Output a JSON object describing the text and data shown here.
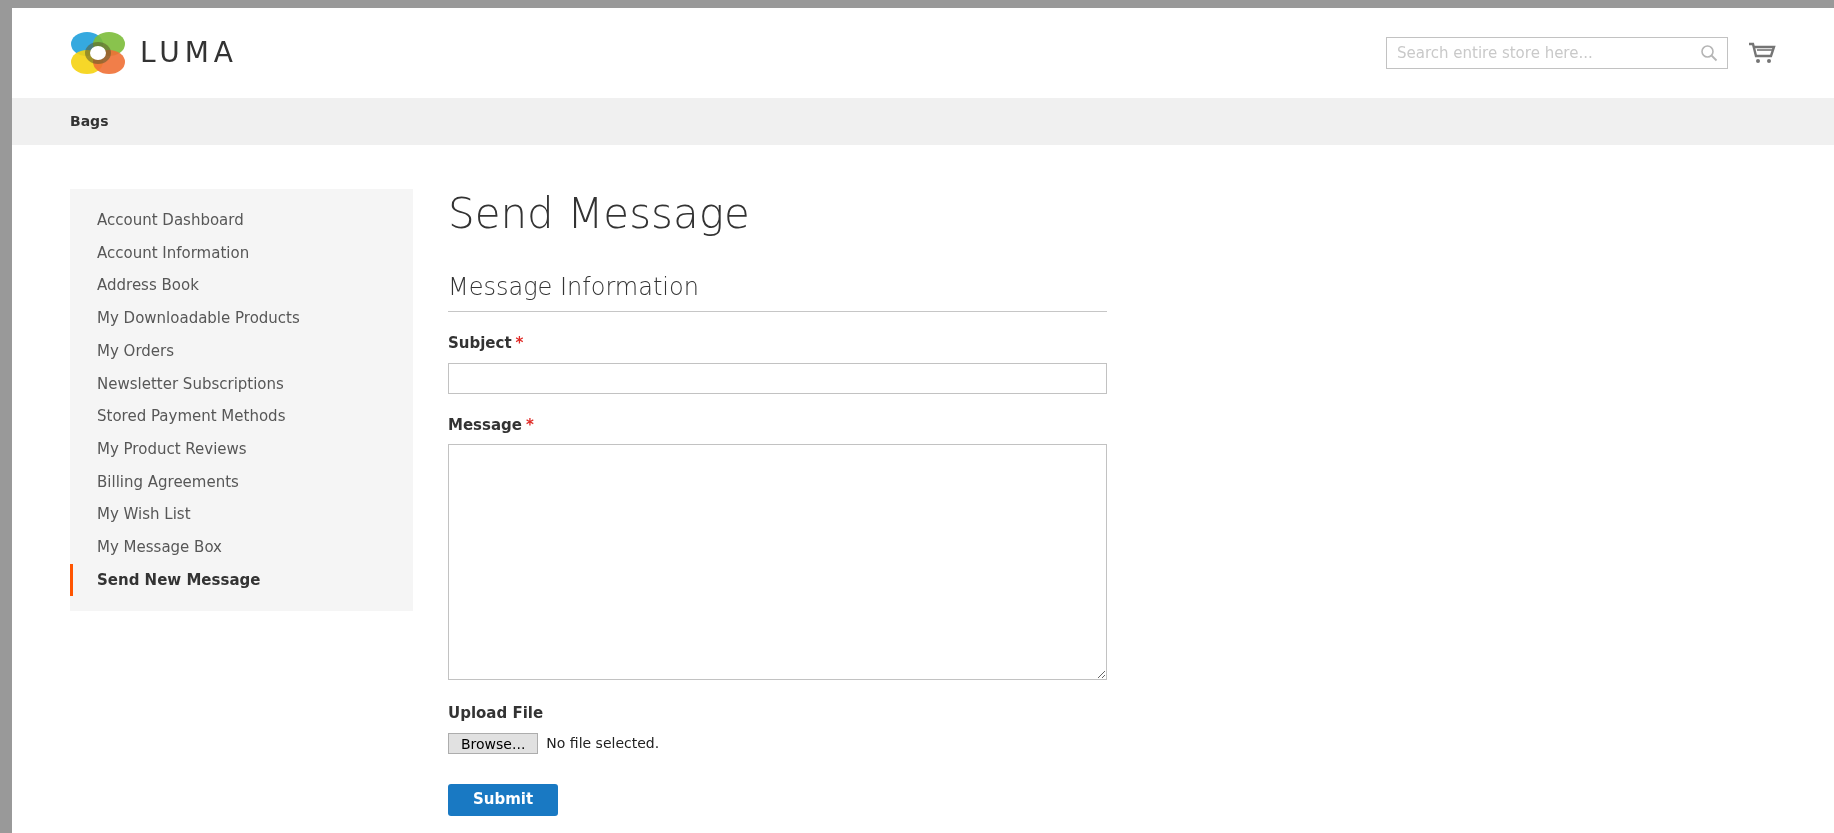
{
  "header": {
    "logo_text": "LUMA",
    "search": {
      "placeholder": "Search entire store here..."
    }
  },
  "nav": {
    "items": [
      {
        "label": "Bags",
        "selected": false
      }
    ]
  },
  "sidebar": {
    "items": [
      {
        "label": "Account Dashboard",
        "selected": false
      },
      {
        "label": "Account Information",
        "selected": false
      },
      {
        "label": "Address Book",
        "selected": false
      },
      {
        "label": "My Downloadable Products",
        "selected": false
      },
      {
        "label": "My Orders",
        "selected": false
      },
      {
        "label": "Newsletter Subscriptions",
        "selected": false
      },
      {
        "label": "Stored Payment Methods",
        "selected": false
      },
      {
        "label": "My Product Reviews",
        "selected": false
      },
      {
        "label": "Billing Agreements",
        "selected": false
      },
      {
        "label": "My Wish List",
        "selected": false
      },
      {
        "label": "My Message Box",
        "selected": false
      },
      {
        "label": "Send New Message",
        "selected": true
      }
    ]
  },
  "page_title": "Send Message",
  "form": {
    "section_title": "Message Information",
    "fields": [
      {
        "kind": "text",
        "label": "Subject",
        "required": "*"
      },
      {
        "kind": "textarea",
        "label": "Message",
        "required": "*"
      },
      {
        "kind": "file",
        "label": "Upload File",
        "button": "Browse...",
        "status": "No file selected."
      }
    ],
    "submit": "Submit"
  }
}
